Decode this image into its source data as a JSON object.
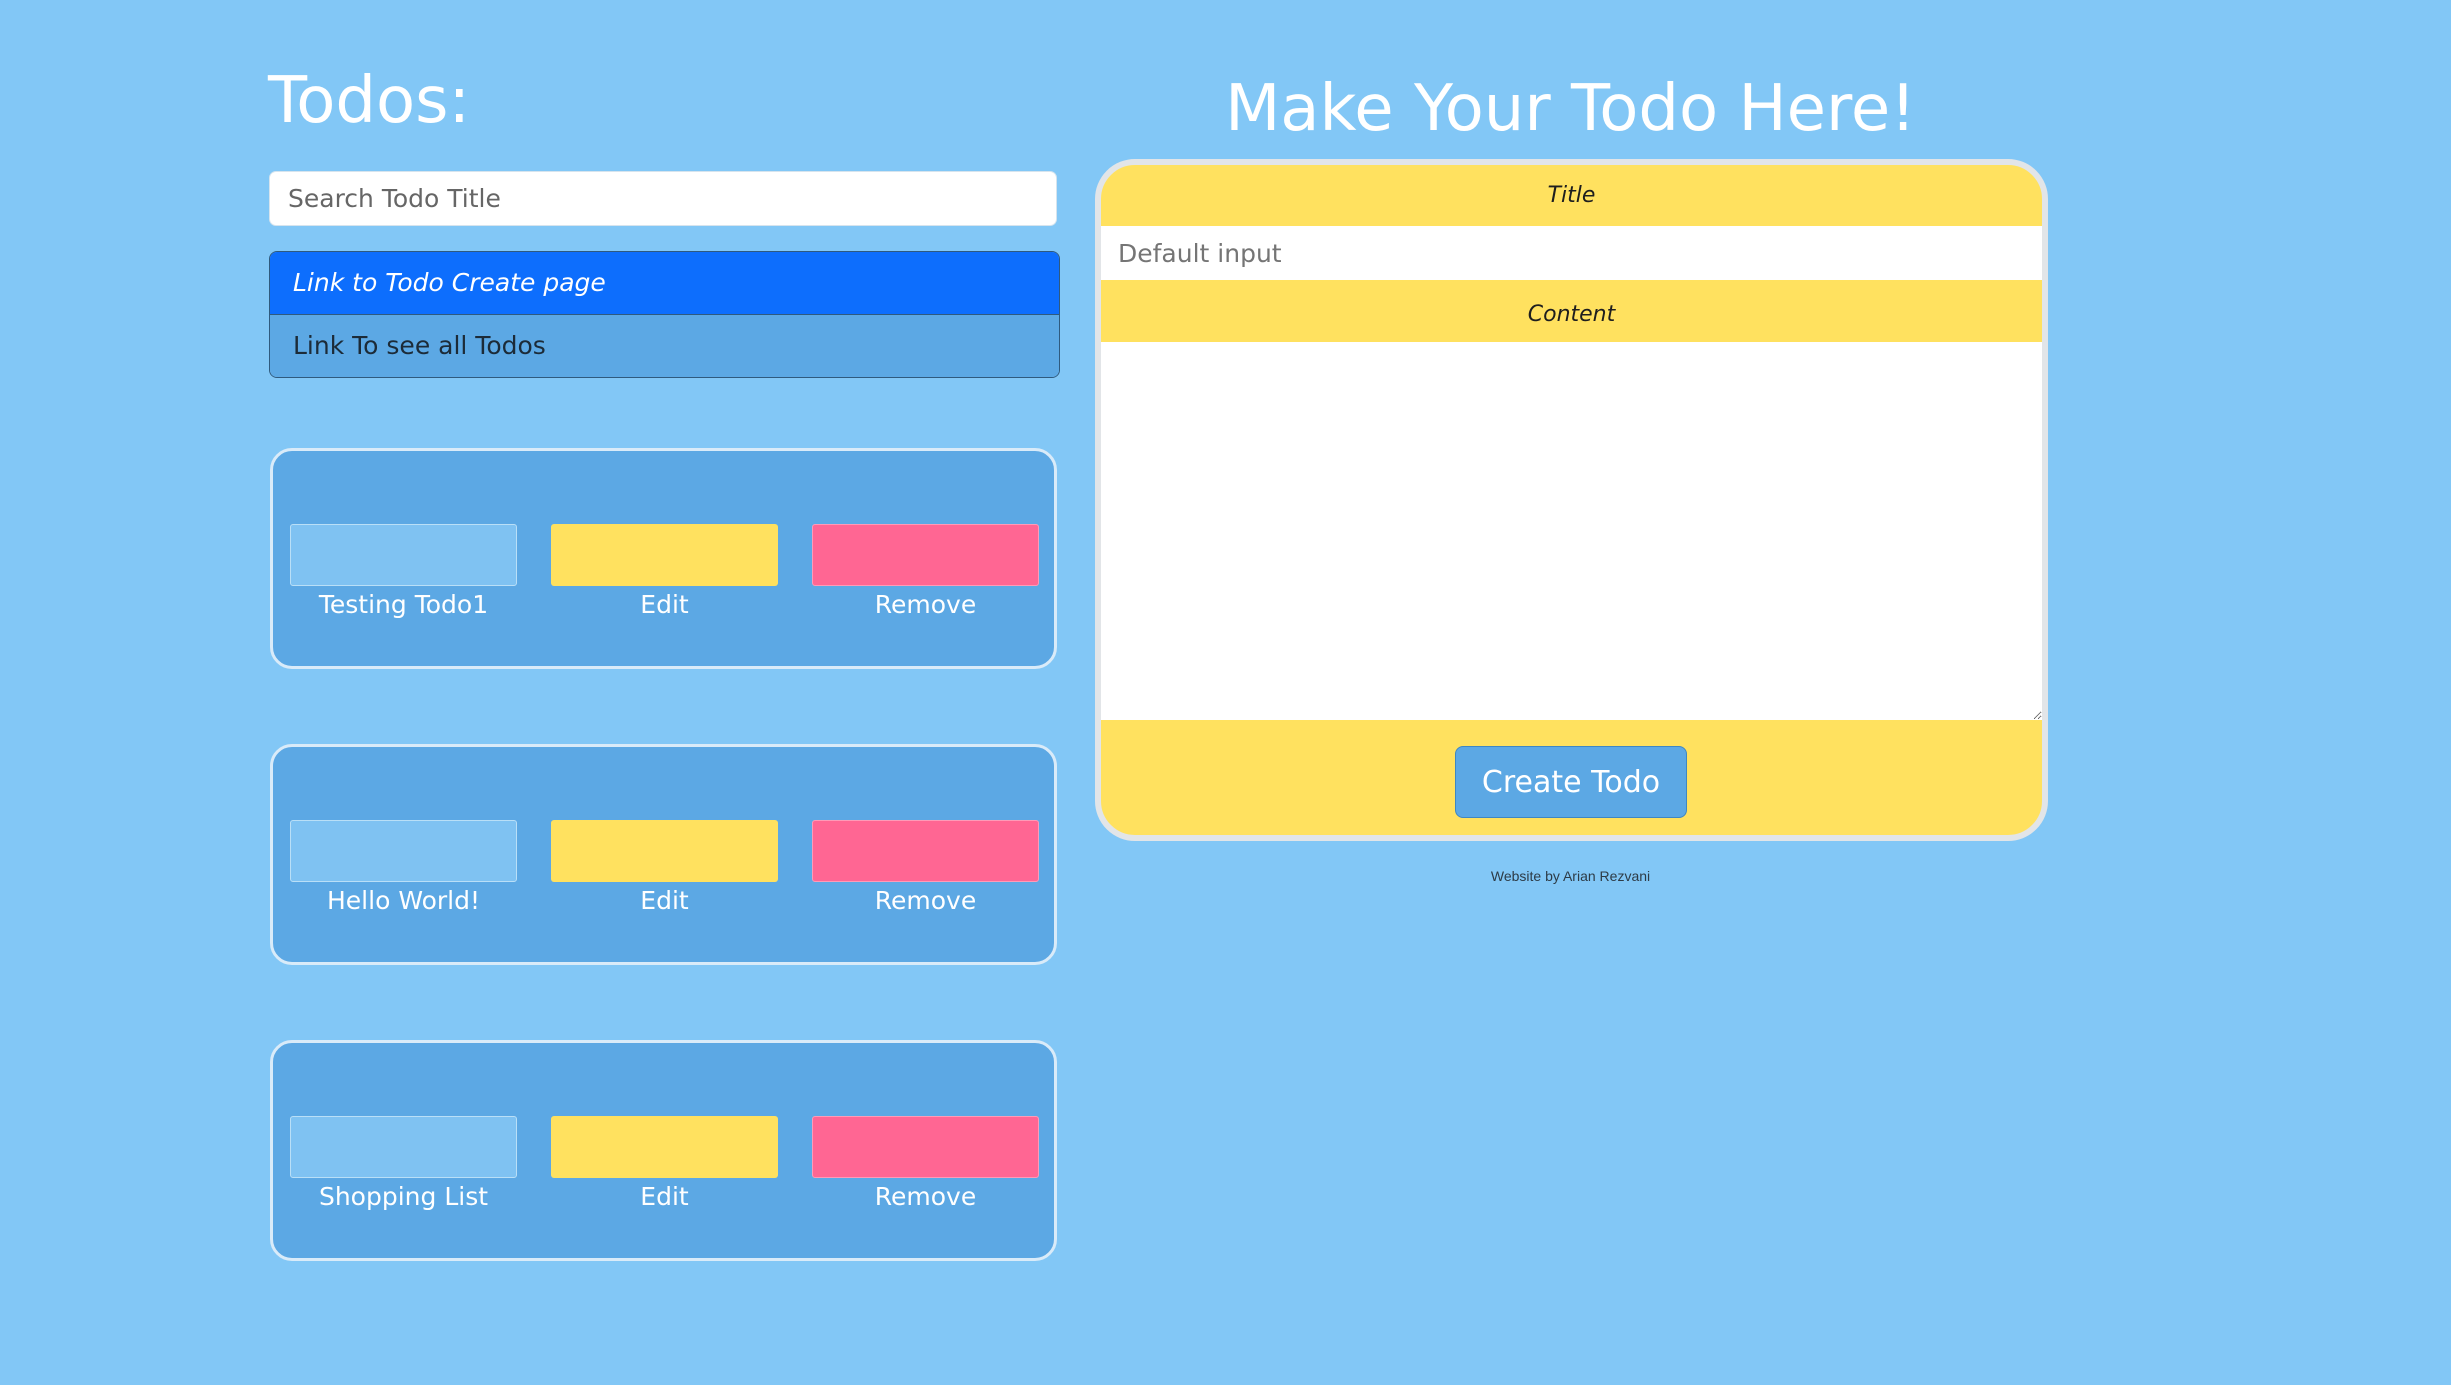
{
  "left": {
    "heading": "Todos:",
    "search": {
      "placeholder": "Search Todo Title",
      "value": ""
    },
    "links": [
      {
        "label": "Link to Todo Create page",
        "active": true
      },
      {
        "label": "Link To see all Todos",
        "active": false
      }
    ],
    "todos": [
      {
        "title": "Testing Todo1",
        "edit_label": "Edit",
        "remove_label": "Remove"
      },
      {
        "title": "Hello World!",
        "edit_label": "Edit",
        "remove_label": "Remove"
      },
      {
        "title": "Shopping List",
        "edit_label": "Edit",
        "remove_label": "Remove"
      }
    ]
  },
  "form": {
    "heading": "Make Your Todo Here!",
    "title_label": "Title",
    "title_input": {
      "placeholder": "Default input",
      "value": ""
    },
    "content_label": "Content",
    "content_value": "",
    "submit_label": "Create Todo"
  },
  "footer": {
    "credit": "Website by Arian Rezvani"
  },
  "colors": {
    "page_background": "#82c7f6",
    "card_background": "#5ca8e4",
    "active_link": "#0d6efd",
    "edit_block": "#ffe15f",
    "remove_block": "#ff6693",
    "form_background": "#ffe15f"
  }
}
